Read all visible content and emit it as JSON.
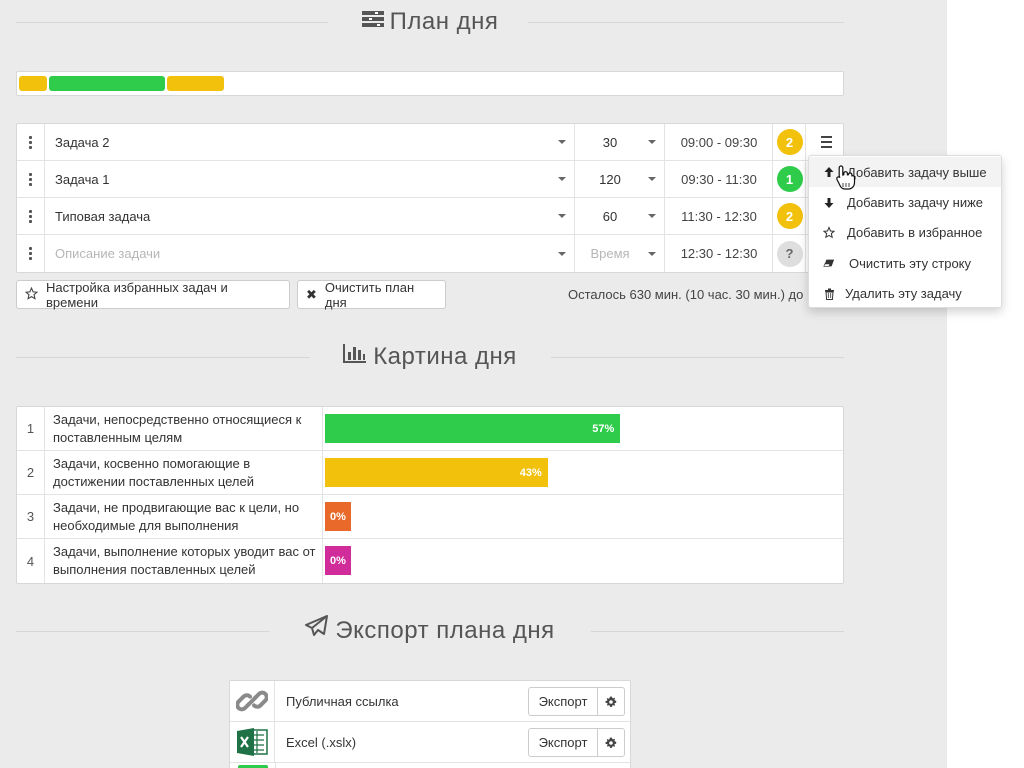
{
  "plan_section": {
    "title": "План дня",
    "icon": "tasks-icon"
  },
  "timeline": [
    {
      "color": "#f2c10c",
      "start_min": 0,
      "duration_min": 30
    },
    {
      "color": "#2ecc4a",
      "start_min": 30,
      "duration_min": 120
    },
    {
      "color": "#f2c10c",
      "start_min": 150,
      "duration_min": 60
    }
  ],
  "timeline_total_min": 840,
  "tasks": [
    {
      "description": "Задача 2",
      "duration": "30",
      "time": "09:00 - 09:30",
      "priority": "2",
      "priority_color": "#f2c10c",
      "placeholder": false
    },
    {
      "description": "Задача 1",
      "duration": "120",
      "time": "09:30 - 11:30",
      "priority": "1",
      "priority_color": "#2ecc4a",
      "placeholder": false
    },
    {
      "description": "Типовая задача",
      "duration": "60",
      "time": "11:30 - 12:30",
      "priority": "2",
      "priority_color": "#f2c10c",
      "placeholder": false
    },
    {
      "description": "Описание задачи",
      "duration": "Время",
      "time": "12:30 - 12:30",
      "priority": "?",
      "priority_color": "#dedede",
      "placeholder": true
    }
  ],
  "buttons": {
    "favorites": "Настройка избранных задач и времени",
    "clear": "Очистить план дня"
  },
  "remaining_text": "Осталось 630 мин. (10 час. 30 мин.) до",
  "row_menu": [
    {
      "label": "Добавить задачу выше",
      "icon": "arrow-up-icon",
      "active": true
    },
    {
      "label": "Добавить задачу ниже",
      "icon": "arrow-down-icon",
      "active": false
    },
    {
      "label": "Добавить в избранное",
      "icon": "star-icon",
      "active": false
    },
    {
      "label": "Очистить эту строку",
      "icon": "eraser-icon",
      "active": false
    },
    {
      "label": "Удалить эту задачу",
      "icon": "trash-icon",
      "active": false
    }
  ],
  "picture_section": {
    "title": "Картина дня",
    "icon": "bar-chart-icon"
  },
  "picture_rows": [
    {
      "num": "1",
      "text": "Задачи, непосредственно относящиеся к поставленным целям",
      "percent": 57,
      "label": "57%",
      "color": "#2ecc4a"
    },
    {
      "num": "2",
      "text": "Задачи, косвенно помогающие в достижении поставленных целей",
      "percent": 43,
      "label": "43%",
      "color": "#f2c10c"
    },
    {
      "num": "3",
      "text": "Задачи, не продвигающие вас к цели, но необходимые для выполнения",
      "percent": 0,
      "label": "0%",
      "color": "#e8692a"
    },
    {
      "num": "4",
      "text": "Задачи, выполнение которых уводит вас от выполнения поставленных целей",
      "percent": 0,
      "label": "0%",
      "color": "#d02c9a"
    }
  ],
  "export_section": {
    "title": "Экспорт плана дня",
    "icon": "paper-plane-icon"
  },
  "export_rows": [
    {
      "label": "Публичная ссылка",
      "button": "Экспорт",
      "icon": "link-icon"
    },
    {
      "label": "Excel (.xslx)",
      "button": "Экспорт",
      "icon": "excel-icon"
    }
  ]
}
